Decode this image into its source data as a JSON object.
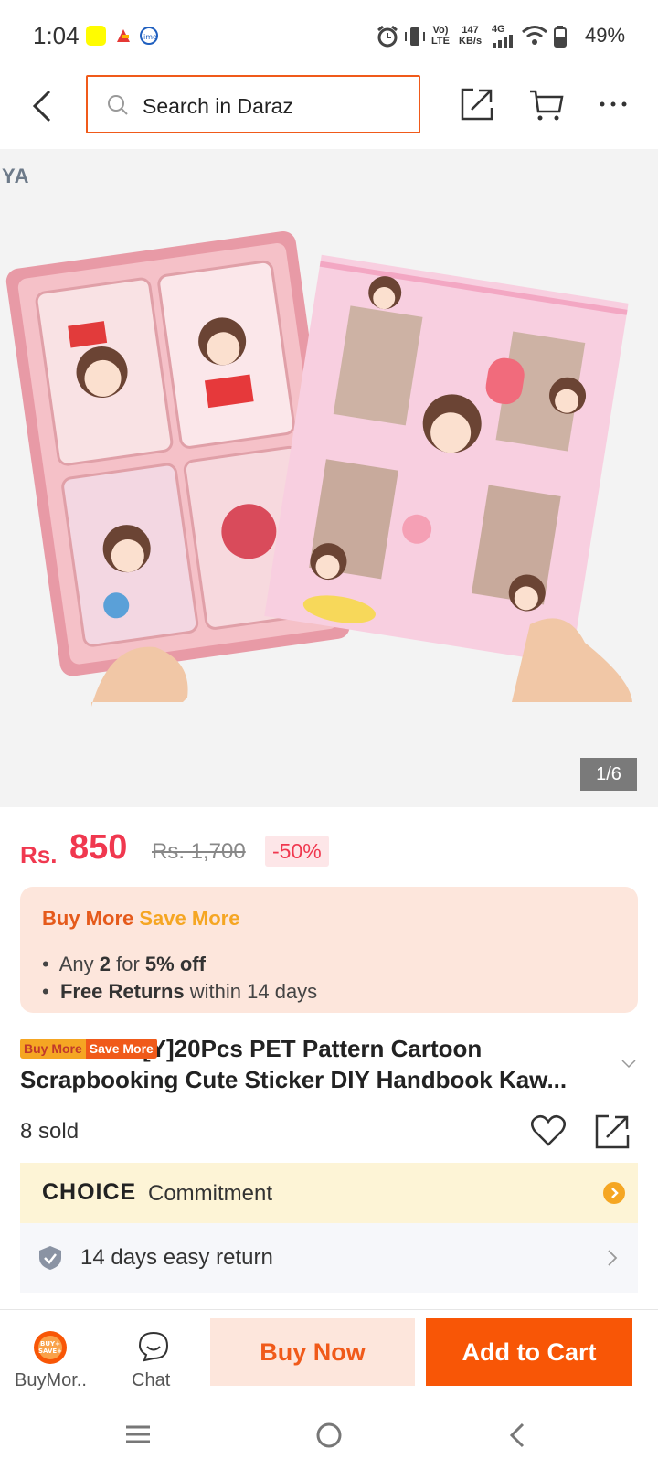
{
  "status_bar": {
    "time": "1:04",
    "net_top": "Vo)",
    "net_bottom": "LTE",
    "speed_top": "147",
    "speed_bottom": "KB/s",
    "net_type": "4G",
    "battery": "49%"
  },
  "header": {
    "search_placeholder": "Search in Daraz"
  },
  "gallery": {
    "brand_mark": "YA",
    "counter": "1/6"
  },
  "price": {
    "currency": "Rs.",
    "current": "850",
    "original": "Rs. 1,700",
    "discount": "-50%"
  },
  "promo": {
    "title_a": "Buy More",
    "title_b": "Save More",
    "line1_a": "Any ",
    "line1_qty": "2",
    "line1_b": " for ",
    "line1_off": "5% off",
    "line2_bold": "Free Returns",
    "line2_rest": " within 14 days"
  },
  "product": {
    "badge_a": "Buy More",
    "badge_b": "Save More",
    "title": "[Y]20Pcs PET Pattern Cartoon Scrapbooking Cute Sticker DIY Handbook Kaw...",
    "sold": "8 sold"
  },
  "choice": {
    "logo": "CHOICE",
    "text": "Commitment"
  },
  "returns": {
    "text": "14 days easy return"
  },
  "bottom_bar": {
    "buymore_label": "BuyMor..",
    "buymore_icon_text": "BUY+ SAVE+",
    "chat_label": "Chat",
    "buy_now": "Buy Now",
    "add_to_cart": "Add to Cart"
  },
  "colors": {
    "brand_orange": "#f85606",
    "price_red": "#f0384f",
    "promo_bg": "#fde6dc",
    "choice_bg": "#fdf4d6"
  }
}
